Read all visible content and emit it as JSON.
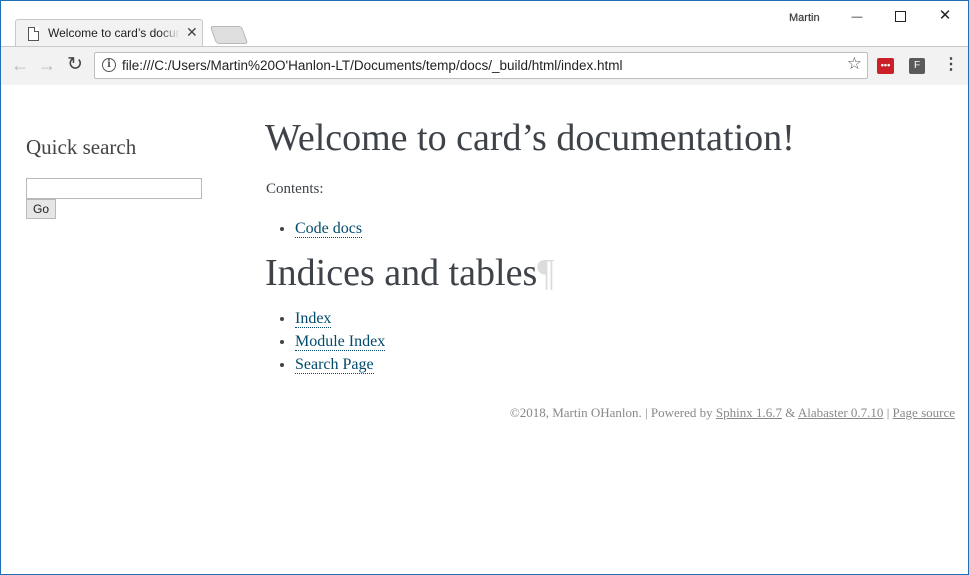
{
  "browser": {
    "tab_title": "Welcome to card’s documentation!",
    "tab_close": "✕",
    "profile_name": "Martin",
    "url": "file:///C:/Users/Martin%20O'Hanlon-LT/Documents/temp/docs/_build/html/index.html",
    "back_glyph": "←",
    "forward_glyph": "→",
    "reload_glyph": "↻",
    "star_glyph": "☆",
    "info_glyph": "i",
    "ext1_label": "•••",
    "ext2_label": "F",
    "menu_glyph": "⋮",
    "min_glyph": "—",
    "close_glyph": "✕",
    "icons": [
      "page-icon",
      "info-icon",
      "star-icon",
      "back-arrow-icon",
      "forward-arrow-icon",
      "reload-icon",
      "menu-icon"
    ]
  },
  "sidebar": {
    "quick_search_title": "Quick search",
    "search_value": "",
    "go_label": "Go"
  },
  "main": {
    "title": "Welcome to card’s documentation!",
    "contents_label": "Contents:",
    "contents_items": [
      {
        "label": "Code docs"
      }
    ],
    "indices_title": "Indices and tables",
    "pilcrow": "¶",
    "indices_items": [
      {
        "label": "Index"
      },
      {
        "label": "Module Index"
      },
      {
        "label": "Search Page"
      }
    ]
  },
  "footer": {
    "copyright": "©2018, Martin OHanlon.",
    "sep1": " | ",
    "powered_by": "Powered by ",
    "sphinx_link": "Sphinx 1.6.7",
    "amp": " & ",
    "alabaster_link": "Alabaster 0.7.10",
    "sep2": " | ",
    "page_source_link": "Page source"
  },
  "colors": {
    "link": "#004b6b",
    "text": "#3e4349",
    "window_border": "#1e6fb8",
    "ext1_bg": "#cc2029"
  }
}
